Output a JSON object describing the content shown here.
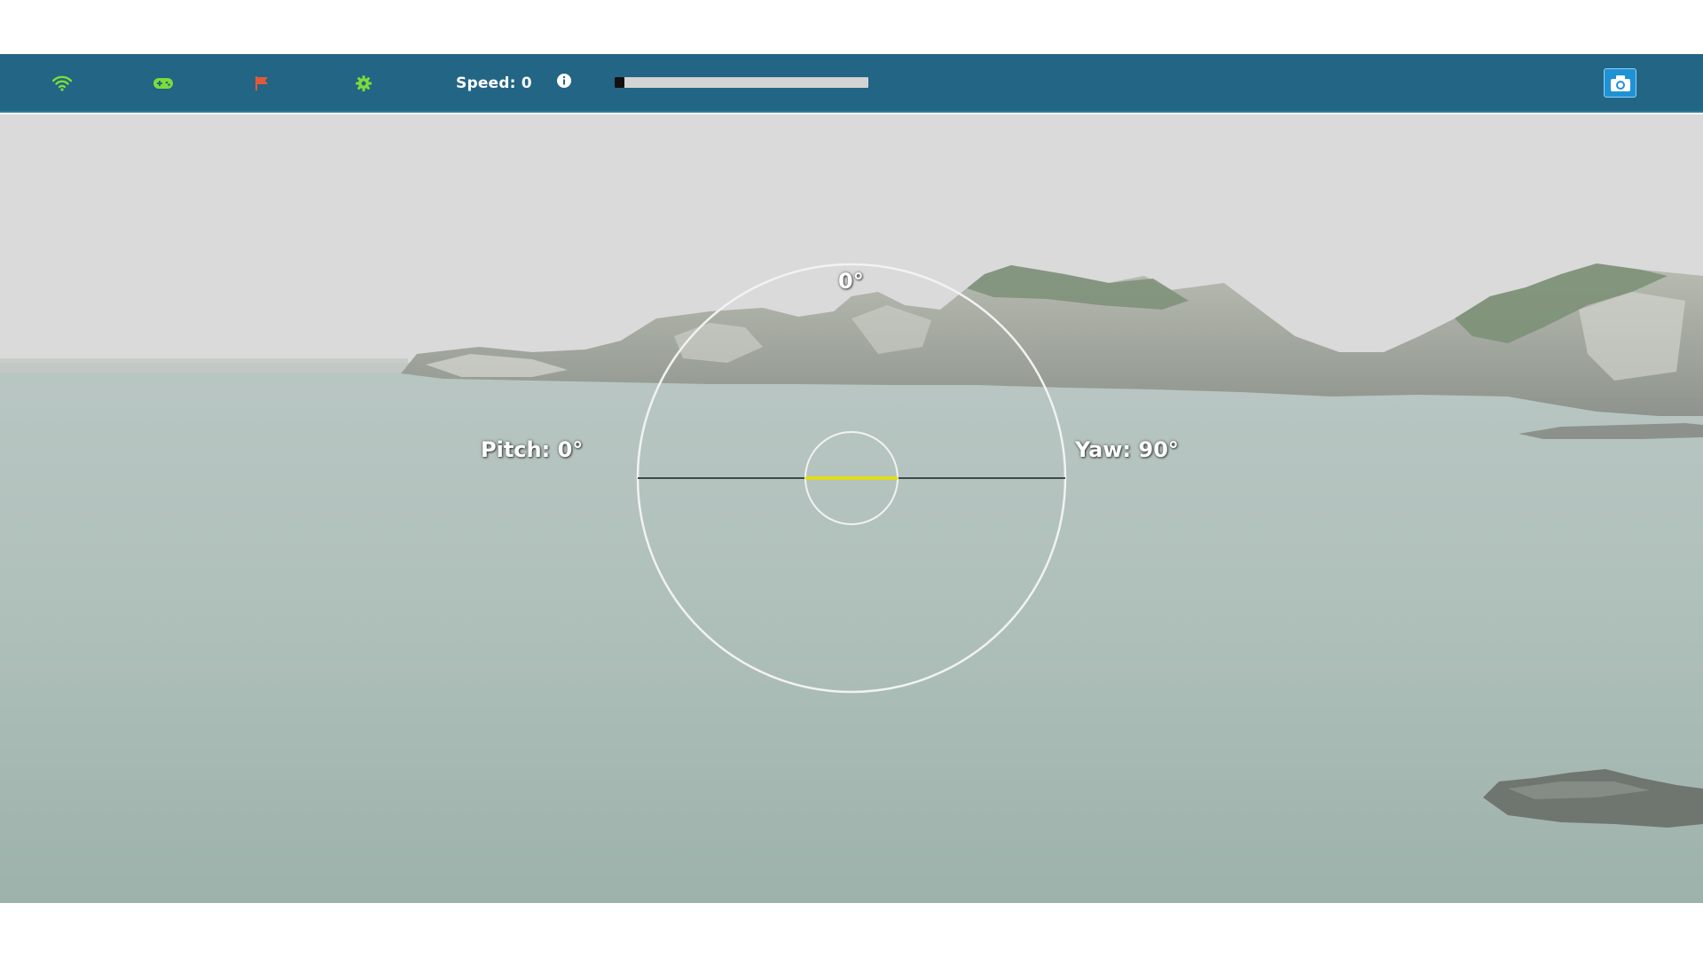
{
  "toolbar": {
    "icons": {
      "wifi": {
        "name": "wifi-icon",
        "color": "#7ddc3a"
      },
      "gamepad": {
        "name": "gamepad-icon",
        "color": "#7ddc3a"
      },
      "flag": {
        "name": "flag-icon",
        "color": "#e05a3a"
      },
      "settings": {
        "name": "gear-icon",
        "color": "#7ddc3a"
      },
      "info": {
        "name": "info-icon",
        "color": "#ffffff"
      },
      "camera": {
        "name": "camera-icon",
        "color": "#ffffff"
      }
    },
    "speed_label": "Speed:",
    "speed_value": "0",
    "progress_fraction": 0.04,
    "background": "#236584"
  },
  "hud": {
    "heading": "0°",
    "pitch_label": "Pitch:",
    "pitch_value": "0°",
    "yaw_label": "Yaw:",
    "yaw_value": "90°",
    "horizon_color": "#e8e000"
  }
}
